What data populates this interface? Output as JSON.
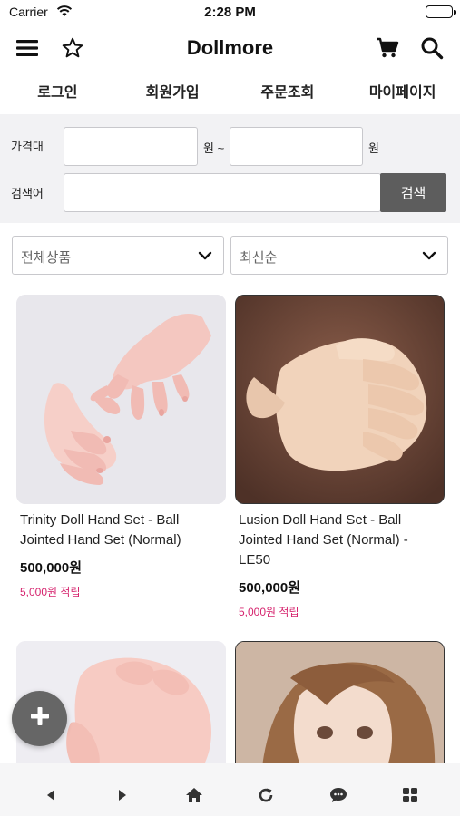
{
  "status_bar": {
    "carrier": "Carrier",
    "time": "2:28 PM"
  },
  "header": {
    "title": "Dollmore",
    "icons": [
      "menu-icon",
      "star-icon",
      "cart-icon",
      "search-icon"
    ]
  },
  "nav": [
    "로그인",
    "회원가입",
    "주문조회",
    "마이페이지"
  ],
  "search_panel": {
    "price_label": "가격대",
    "min_value": "",
    "separator": "원 ~",
    "max_value": "",
    "unit": "원",
    "keyword_label": "검색어",
    "keyword_value": "",
    "search_button": "검색"
  },
  "filters": {
    "category": "전체상품",
    "sort": "최신순"
  },
  "products": [
    {
      "name": "Trinity Doll Hand Set - Ball Jointed Hand Set (Normal)",
      "price": "500,000원",
      "points": "5,000원 적립"
    },
    {
      "name": "Lusion Doll Hand Set - Ball Jointed Hand Set (Normal) - LE50",
      "price": "500,000원",
      "points": "5,000원 적립"
    }
  ],
  "fab": {
    "icon": "plus-icon"
  },
  "bottom_bar": [
    "back-icon",
    "forward-icon",
    "home-icon",
    "refresh-icon",
    "chat-icon",
    "grid-icon"
  ],
  "colors": {
    "points_text": "#d6246e",
    "search_button_bg": "#5d5d5d",
    "panel_bg": "#f2f2f4"
  }
}
